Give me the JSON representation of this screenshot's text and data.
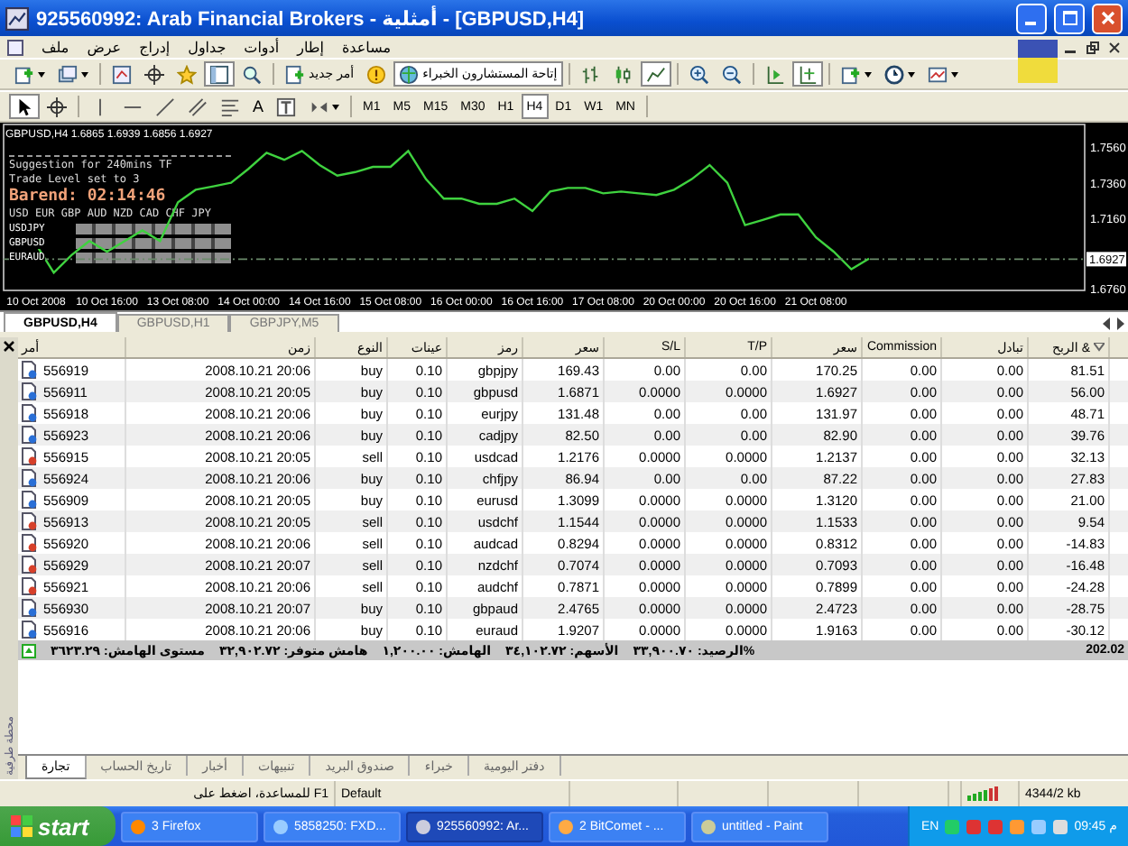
{
  "window": {
    "title": "925560992: Arab Financial Brokers - أمثلية - [GBPUSD,H4]"
  },
  "menu": [
    "مساعدة",
    "إطار",
    "أدوات",
    "جداول",
    "إدراج",
    "عرض",
    "ملف"
  ],
  "toolbar": {
    "new_order": "أمر جديد",
    "experts": "إتاحة المستشارون الخبراء",
    "text_tool": "A"
  },
  "timeframes": [
    {
      "label": "M1",
      "selected": false
    },
    {
      "label": "M5",
      "selected": false
    },
    {
      "label": "M15",
      "selected": false
    },
    {
      "label": "M30",
      "selected": false
    },
    {
      "label": "H1",
      "selected": false
    },
    {
      "label": "H4",
      "selected": true
    },
    {
      "label": "D1",
      "selected": false
    },
    {
      "label": "W1",
      "selected": false
    },
    {
      "label": "MN",
      "selected": false
    }
  ],
  "chart": {
    "header": "GBPUSD,H4 1.6865 1.6939 1.6856 1.6927",
    "current_price": "1.6927",
    "indicator": {
      "lines": [
        "Suggestion for 240mins TF",
        "Trade Level set to 3"
      ],
      "timer": "Barend: 02:14:46",
      "currencies": "USD EUR GBP AUD NZD CAD CHF JPY",
      "pairs": [
        "USDJPY",
        "GBPUSD",
        "EURAUD"
      ]
    },
    "chart_data": {
      "type": "line",
      "categories": [
        "10 Oct 2008",
        null,
        null,
        null,
        "10 Oct 16:00",
        null,
        null,
        null,
        "13 Oct 08:00",
        null,
        null,
        null,
        "14 Oct 00:00",
        null,
        null,
        null,
        "14 Oct 16:00",
        null,
        null,
        null,
        "15 Oct 08:00",
        null,
        null,
        null,
        "16 Oct 00:00",
        null,
        null,
        null,
        "16 Oct 16:00",
        null,
        null,
        null,
        "17 Oct 08:00",
        null,
        null,
        null,
        "20 Oct 00:00",
        null,
        null,
        null,
        "20 Oct 16:00",
        null,
        null,
        null,
        "21 Oct 08:00",
        null,
        null,
        null
      ],
      "series": [
        {
          "color": "#3fd23f",
          "values": [
            1.701,
            1.685,
            1.695,
            1.703,
            1.697,
            1.703,
            1.709,
            1.703,
            1.725,
            1.732,
            1.734,
            1.736,
            1.744,
            1.753,
            1.749,
            1.754,
            1.746,
            1.74,
            1.742,
            1.745,
            1.745,
            1.754,
            1.738,
            1.727,
            1.727,
            1.724,
            1.724,
            1.727,
            1.72,
            1.731,
            1.733,
            1.733,
            1.73,
            1.731,
            1.73,
            1.729,
            1.732,
            1.738,
            1.746,
            1.736,
            1.712,
            1.715,
            1.718,
            1.718,
            1.705,
            1.697,
            1.687,
            1.693
          ]
        }
      ],
      "ref_lines": [
        {
          "axis": "y",
          "value": 1.6927
        }
      ],
      "ylim": [
        1.675,
        1.769
      ],
      "yticks": [
        {
          "value": 1.676,
          "label": "1.6760"
        },
        {
          "value": 1.716,
          "label": "1.7160"
        },
        {
          "value": 1.736,
          "label": "1.7360"
        },
        {
          "value": 1.756,
          "label": "1.7560"
        }
      ]
    }
  },
  "chart_tabs": [
    {
      "label": "GBPUSD,H4",
      "selected": true
    },
    {
      "label": "GBPUSD,H1",
      "selected": false
    },
    {
      "label": "GBPJPY,M5",
      "selected": false
    }
  ],
  "terminal": {
    "title": "محطة طرفية",
    "columns": [
      "أمر",
      "زمن",
      "النوع",
      "عينات",
      "رمز",
      "سعر",
      "S/L",
      "T/P",
      "سعر",
      "Commission",
      "تبادل",
      "الربح &"
    ],
    "rows": [
      {
        "kind": "buy",
        "cells": [
          "556919",
          "2008.10.21 20:06",
          "buy",
          "0.10",
          "gbpjpy",
          "169.43",
          "0.00",
          "0.00",
          "170.25",
          "0.00",
          "0.00",
          "81.51"
        ]
      },
      {
        "kind": "buy",
        "cells": [
          "556911",
          "2008.10.21 20:05",
          "buy",
          "0.10",
          "gbpusd",
          "1.6871",
          "0.0000",
          "0.0000",
          "1.6927",
          "0.00",
          "0.00",
          "56.00"
        ]
      },
      {
        "kind": "buy",
        "cells": [
          "556918",
          "2008.10.21 20:06",
          "buy",
          "0.10",
          "eurjpy",
          "131.48",
          "0.00",
          "0.00",
          "131.97",
          "0.00",
          "0.00",
          "48.71"
        ]
      },
      {
        "kind": "buy",
        "cells": [
          "556923",
          "2008.10.21 20:06",
          "buy",
          "0.10",
          "cadjpy",
          "82.50",
          "0.00",
          "0.00",
          "82.90",
          "0.00",
          "0.00",
          "39.76"
        ]
      },
      {
        "kind": "sell",
        "cells": [
          "556915",
          "2008.10.21 20:05",
          "sell",
          "0.10",
          "usdcad",
          "1.2176",
          "0.0000",
          "0.0000",
          "1.2137",
          "0.00",
          "0.00",
          "32.13"
        ]
      },
      {
        "kind": "buy",
        "cells": [
          "556924",
          "2008.10.21 20:06",
          "buy",
          "0.10",
          "chfjpy",
          "86.94",
          "0.00",
          "0.00",
          "87.22",
          "0.00",
          "0.00",
          "27.83"
        ]
      },
      {
        "kind": "buy",
        "cells": [
          "556909",
          "2008.10.21 20:05",
          "buy",
          "0.10",
          "eurusd",
          "1.3099",
          "0.0000",
          "0.0000",
          "1.3120",
          "0.00",
          "0.00",
          "21.00"
        ]
      },
      {
        "kind": "sell",
        "cells": [
          "556913",
          "2008.10.21 20:05",
          "sell",
          "0.10",
          "usdchf",
          "1.1544",
          "0.0000",
          "0.0000",
          "1.1533",
          "0.00",
          "0.00",
          "9.54"
        ]
      },
      {
        "kind": "sell",
        "cells": [
          "556920",
          "2008.10.21 20:06",
          "sell",
          "0.10",
          "audcad",
          "0.8294",
          "0.0000",
          "0.0000",
          "0.8312",
          "0.00",
          "0.00",
          "-14.83"
        ]
      },
      {
        "kind": "sell",
        "cells": [
          "556929",
          "2008.10.21 20:07",
          "sell",
          "0.10",
          "nzdchf",
          "0.7074",
          "0.0000",
          "0.0000",
          "0.7093",
          "0.00",
          "0.00",
          "-16.48"
        ]
      },
      {
        "kind": "sell",
        "cells": [
          "556921",
          "2008.10.21 20:06",
          "sell",
          "0.10",
          "audchf",
          "0.7871",
          "0.0000",
          "0.0000",
          "0.7899",
          "0.00",
          "0.00",
          "-24.28"
        ]
      },
      {
        "kind": "buy",
        "cells": [
          "556930",
          "2008.10.21 20:07",
          "buy",
          "0.10",
          "gbpaud",
          "2.4765",
          "0.0000",
          "0.0000",
          "2.4723",
          "0.00",
          "0.00",
          "-28.75"
        ]
      },
      {
        "kind": "buy",
        "cells": [
          "556916",
          "2008.10.21 20:06",
          "buy",
          "0.10",
          "euraud",
          "1.9207",
          "0.0000",
          "0.0000",
          "1.9163",
          "0.00",
          "0.00",
          "-30.12"
        ]
      }
    ],
    "summary": {
      "items": [
        "%الرصيد: ٣٣,٩٠٠.٧٠",
        "الأسهم: ٣٤,١٠٢.٧٢",
        "الهامش: ١,٢٠٠.٠٠",
        "هامش متوفر: ٣٢,٩٠٢.٧٢",
        "مستوى الهامش: ٣٦٢٣.٢٩"
      ],
      "profit": "202.02"
    },
    "tabs": [
      {
        "label": "دفتر اليومية",
        "selected": false
      },
      {
        "label": "خبراء",
        "selected": false
      },
      {
        "label": "صندوق البريد",
        "selected": false
      },
      {
        "label": "تنبيهات",
        "selected": false
      },
      {
        "label": "أخبار",
        "selected": false
      },
      {
        "label": "تاريخ الحساب",
        "selected": false
      },
      {
        "label": "تجارة",
        "selected": true
      }
    ]
  },
  "status_bar": {
    "help": "F1 للمساعدة، اضغط على",
    "profile": "Default",
    "traffic": "4344/2 kb"
  },
  "taskbar": {
    "start": "start",
    "items": [
      {
        "label": "3 Firefox",
        "selected": false
      },
      {
        "label": "5858250: FXD...",
        "selected": false
      },
      {
        "label": "925560992: Ar...",
        "selected": true
      },
      {
        "label": "2 BitComet - ...",
        "selected": false
      },
      {
        "label": "untitled - Paint",
        "selected": false
      }
    ],
    "language": "EN",
    "clock": "09:45 م"
  }
}
